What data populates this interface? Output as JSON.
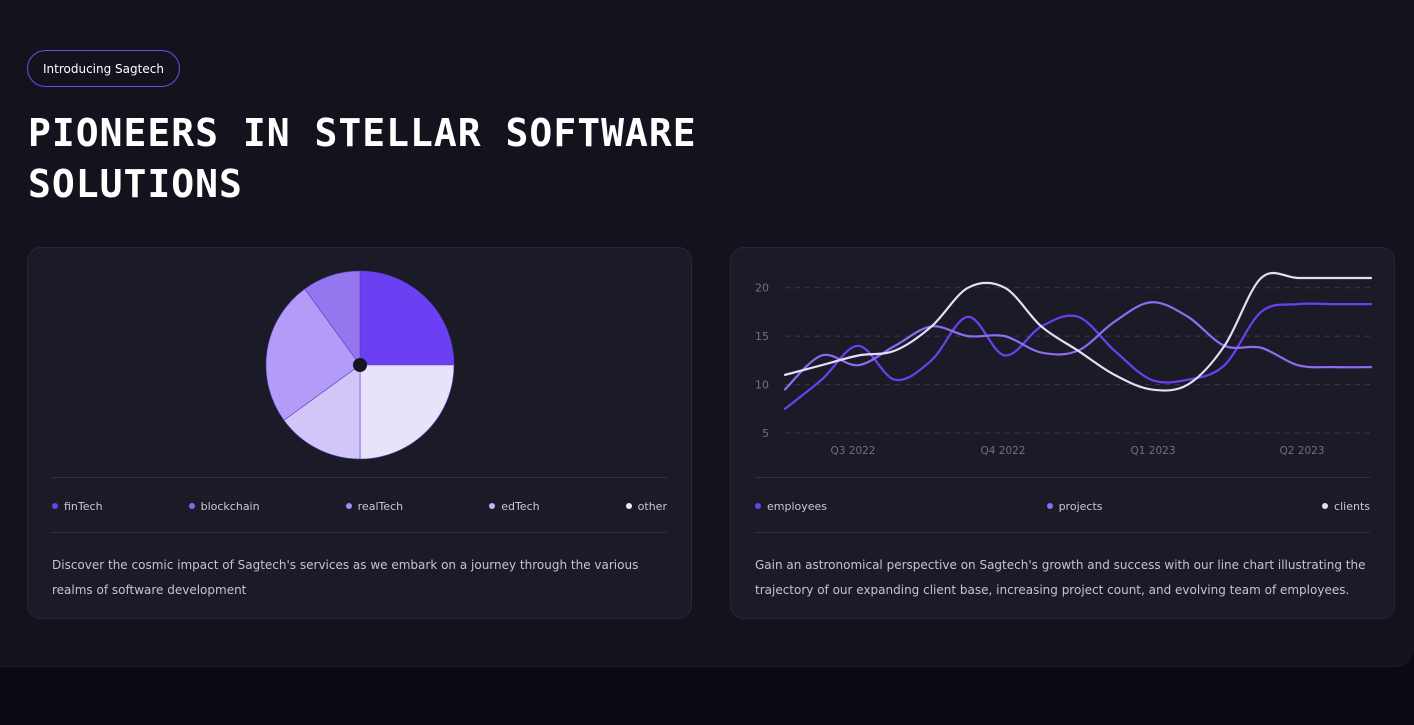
{
  "header": {
    "badge": "Introducing Sagtech",
    "title": "PIONEERS IN STELLAR SOFTWARE SOLUTIONS"
  },
  "colors": {
    "accent": "#6b3ff2",
    "panel": "#13131d",
    "card": "#1b1b27"
  },
  "pie_card": {
    "description": "Discover the cosmic impact of Sagtech's services as we embark on a journey through the various realms of software development"
  },
  "line_card": {
    "description": "Gain an astronomical perspective on Sagtech's growth and success with our line chart illustrating the trajectory of our expanding client base, increasing project count, and evolving team of employees."
  },
  "chart_data": [
    {
      "type": "pie",
      "title": "",
      "legend_position": "bottom",
      "slices": [
        {
          "label": "finTech",
          "value": 25,
          "color": "#6b3ff2"
        },
        {
          "label": "other",
          "value": 25,
          "color": "#e8e2fa"
        },
        {
          "label": "edTech",
          "value": 15,
          "color": "#d2c6f8"
        },
        {
          "label": "realTech",
          "value": 25,
          "color": "#b39cf7"
        },
        {
          "label": "blockchain",
          "value": 10,
          "color": "#9477ee"
        }
      ],
      "legend": [
        {
          "label": "finTech",
          "color": "#6b3ff2"
        },
        {
          "label": "blockchain",
          "color": "#8a65f0"
        },
        {
          "label": "realTech",
          "color": "#a58af4"
        },
        {
          "label": "edTech",
          "color": "#c4b3f8"
        },
        {
          "label": "other",
          "color": "#ece8fb"
        }
      ]
    },
    {
      "type": "line",
      "title": "",
      "xlabel": "",
      "ylabel": "",
      "ylim": [
        5,
        21
      ],
      "x": [
        0,
        0.25,
        0.5,
        0.75,
        1,
        1.25,
        1.5,
        1.75,
        2,
        2.25,
        2.5,
        2.75,
        3,
        3.25,
        3.5,
        3.75,
        4
      ],
      "categories": [
        "Q3 2022",
        "Q4 2022",
        "Q1 2023",
        "Q2 2023"
      ],
      "y_ticks": [
        5,
        10,
        15,
        20
      ],
      "grid": true,
      "legend_position": "bottom",
      "series": [
        {
          "name": "employees",
          "color": "#6b3ff2",
          "values": [
            7.5,
            10.5,
            14,
            10.5,
            12.5,
            17,
            13,
            16,
            17,
            13.5,
            10.5,
            10.5,
            12,
            17.5,
            18.3,
            18.3,
            18.3
          ]
        },
        {
          "name": "projects",
          "color": "#8e6bf0",
          "values": [
            9.5,
            13,
            12,
            14,
            16,
            15,
            15,
            13.3,
            13.5,
            16.5,
            18.5,
            17,
            14,
            13.8,
            12,
            11.8,
            11.8
          ]
        },
        {
          "name": "clients",
          "color": "#e4ddf8",
          "values": [
            11,
            12,
            13,
            13.5,
            16,
            20,
            20,
            16,
            13.5,
            11,
            9.5,
            10,
            14,
            21,
            21,
            21,
            21
          ]
        }
      ]
    }
  ]
}
